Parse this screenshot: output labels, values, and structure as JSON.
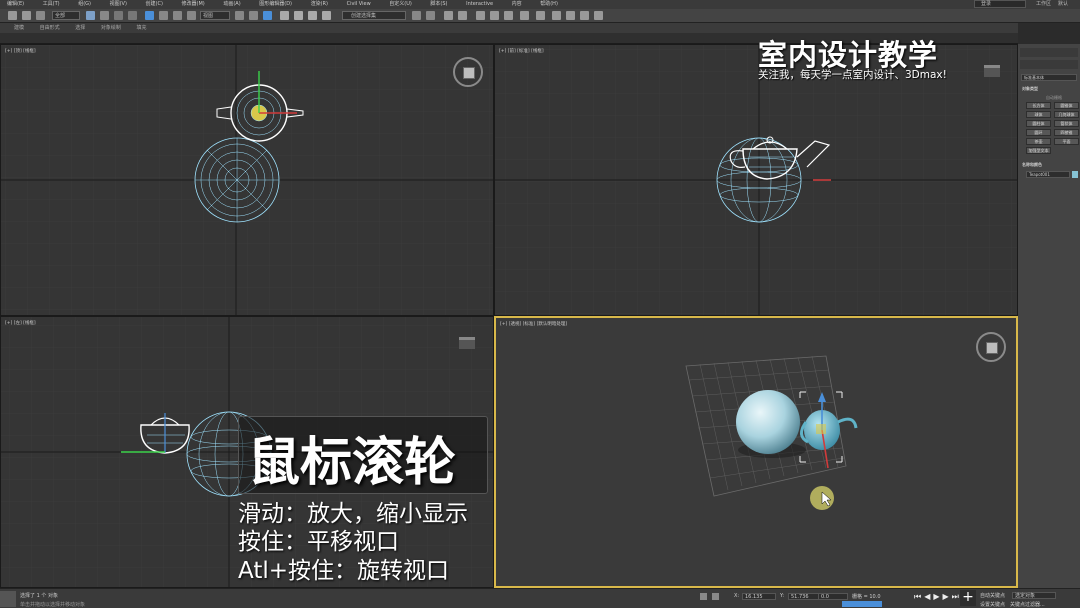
{
  "menu": [
    "编辑(E)",
    "工具(T)",
    "组(G)",
    "视图(V)",
    "创建(C)",
    "修改器(M)",
    "动画(A)",
    "图形编辑器(D)",
    "渲染(R)",
    "Civil View",
    "自定义(U)",
    "脚本(S)",
    "Interactive",
    "内容",
    "帮助(H)"
  ],
  "user": {
    "login": "登录",
    "workspace": "工作区",
    "default": "默认"
  },
  "toolbar": {
    "filter": "全部",
    "view": "视图",
    "selection_set": "创建选择集"
  },
  "ribbon": [
    "建模",
    "自由形式",
    "选择",
    "对象绘制",
    "填充"
  ],
  "viewports": {
    "top_left": "[+] [顶] [线框]",
    "top_right": "[+] [前] [标准] [线框]",
    "bottom_left": "[+] [左] [线框]",
    "bottom_right": "[+] [透视] [标准] [默认明暗处理]"
  },
  "watermark": {
    "title": "室内设计教学",
    "subtitle": "关注我，每天学一点室内设计、3Dmax!"
  },
  "overlay": {
    "title": "鼠标滚轮",
    "line1": "滑动：放大，缩小显示",
    "line2": "按住：平移视口",
    "line3": "Atl+按住：旋转视口"
  },
  "command_panel": {
    "category": "标准基本体",
    "rollout_object_type": "对象类型",
    "autogrid": "自动栅格",
    "buttons": [
      "长方体",
      "圆锥体",
      "球体",
      "几何球体",
      "圆柱体",
      "管状体",
      "圆环",
      "四棱锥",
      "茶壶",
      "平面"
    ],
    "extended": "加强型文本",
    "rollout_name_color": "名称和颜色",
    "object_name": "Teapot001"
  },
  "status": {
    "selected": "选择了 1 个 对象",
    "hint": "单击并拖动以选择并移动对象",
    "x": "16.135",
    "y": "51.736",
    "z": "0.0",
    "grid": "栅格 = 10.0",
    "auto_key": "自动关键点",
    "set_key": "设置关键点",
    "selected_obj": "选定对象",
    "key_filter": "关键点过滤器..."
  },
  "colors": {
    "accent": "#4a8fd9",
    "wire": "#9fe3ff",
    "object": "#86c3d4",
    "selection": "#ffffff"
  }
}
